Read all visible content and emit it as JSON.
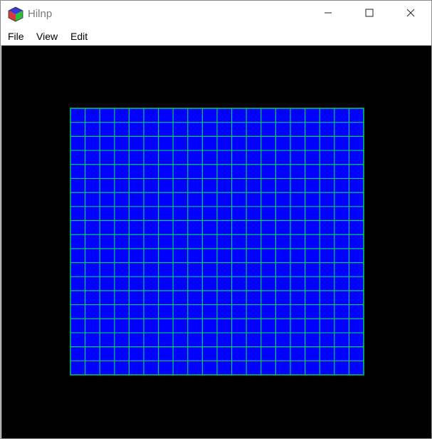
{
  "window": {
    "title": "Hilnp",
    "icon": "rgb-cube-icon",
    "controls": {
      "minimize_icon": "minimize-icon",
      "maximize_icon": "maximize-icon",
      "close_icon": "close-icon"
    }
  },
  "menu": {
    "file": "File",
    "view": "View",
    "edit": "Edit"
  },
  "viewport": {
    "background": "#000000",
    "mesh": {
      "fill": "#0000ff",
      "line_color": "#00cc66",
      "columns": 20,
      "rows": 19
    }
  }
}
